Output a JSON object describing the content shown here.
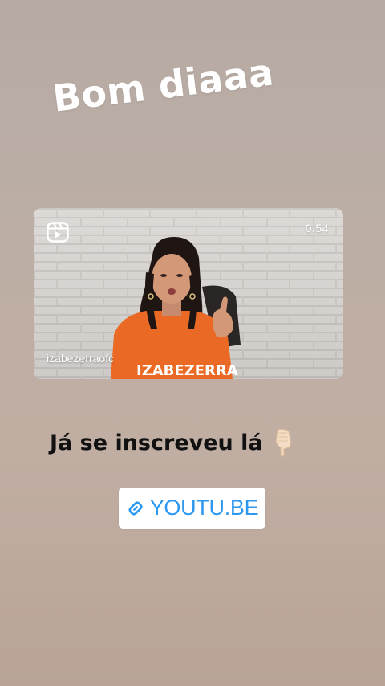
{
  "story": {
    "greeting": "Bom diaaa",
    "video": {
      "duration": "0:54",
      "username": "izabezerraofc",
      "shirt_text": "IZABEZERRA",
      "icon": "reels-icon"
    },
    "caption": "Já se inscreveu lá",
    "caption_emoji_icon": "pointing-down-hand-icon",
    "link": {
      "label": "YOUTU.BE",
      "icon": "link-icon",
      "color": "#2d98f0"
    }
  }
}
